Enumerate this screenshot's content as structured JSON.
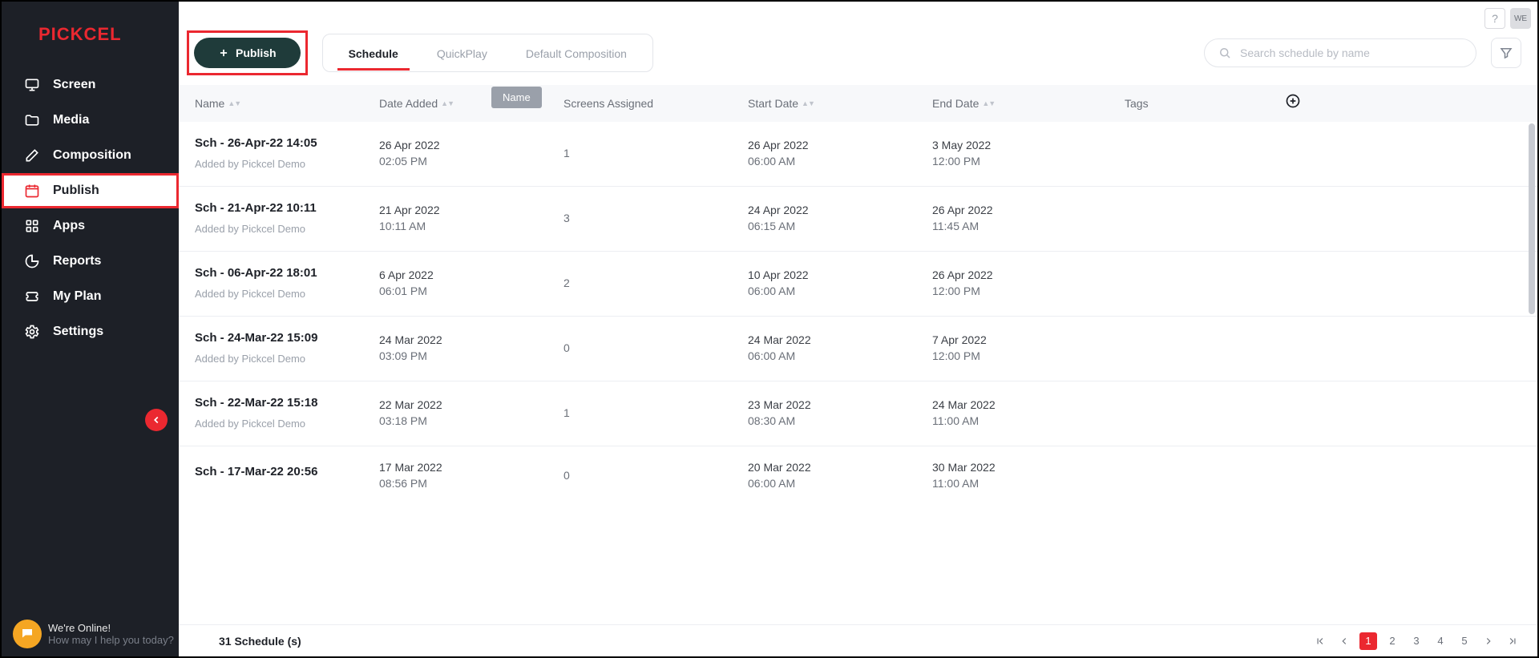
{
  "brand": "PICKCEL",
  "sidebar": {
    "items": [
      {
        "label": "Screen"
      },
      {
        "label": "Media"
      },
      {
        "label": "Composition"
      },
      {
        "label": "Publish"
      },
      {
        "label": "Apps"
      },
      {
        "label": "Reports"
      },
      {
        "label": "My Plan"
      },
      {
        "label": "Settings"
      }
    ],
    "online": {
      "line1": "We're Online!",
      "line2": "How may I help you today?"
    }
  },
  "topbar": {
    "help": "?",
    "avatar": "WE"
  },
  "toolbar": {
    "publish_label": "Publish",
    "tabs": [
      {
        "label": "Schedule"
      },
      {
        "label": "QuickPlay"
      },
      {
        "label": "Default Composition"
      }
    ],
    "search_placeholder": "Search schedule by name"
  },
  "columns": {
    "name": "Name",
    "date_added": "Date Added",
    "screens": "Screens Assigned",
    "start": "Start Date",
    "end": "End Date",
    "tags": "Tags",
    "name_tooltip": "Name"
  },
  "rows": [
    {
      "name": "Sch - 26-Apr-22 14:05",
      "sub": "Added by Pickcel Demo",
      "added_d": "26 Apr 2022",
      "added_t": "02:05 PM",
      "screens": "1",
      "start_d": "26 Apr 2022",
      "start_t": "06:00 AM",
      "end_d": "3 May 2022",
      "end_t": "12:00 PM"
    },
    {
      "name": "Sch - 21-Apr-22 10:11",
      "sub": "Added by Pickcel Demo",
      "added_d": "21 Apr 2022",
      "added_t": "10:11 AM",
      "screens": "3",
      "start_d": "24 Apr 2022",
      "start_t": "06:15 AM",
      "end_d": "26 Apr 2022",
      "end_t": "11:45 AM"
    },
    {
      "name": "Sch - 06-Apr-22 18:01",
      "sub": "Added by Pickcel Demo",
      "added_d": "6 Apr 2022",
      "added_t": "06:01 PM",
      "screens": "2",
      "start_d": "10 Apr 2022",
      "start_t": "06:00 AM",
      "end_d": "26 Apr 2022",
      "end_t": "12:00 PM"
    },
    {
      "name": "Sch - 24-Mar-22 15:09",
      "sub": "Added by Pickcel Demo",
      "added_d": "24 Mar 2022",
      "added_t": "03:09 PM",
      "screens": "0",
      "start_d": "24 Mar 2022",
      "start_t": "06:00 AM",
      "end_d": "7 Apr 2022",
      "end_t": "12:00 PM"
    },
    {
      "name": "Sch - 22-Mar-22 15:18",
      "sub": "Added by Pickcel Demo",
      "added_d": "22 Mar 2022",
      "added_t": "03:18 PM",
      "screens": "1",
      "start_d": "23 Mar 2022",
      "start_t": "08:30 AM",
      "end_d": "24 Mar 2022",
      "end_t": "11:00 AM"
    },
    {
      "name": "Sch - 17-Mar-22 20:56",
      "sub": "",
      "added_d": "17 Mar 2022",
      "added_t": "08:56 PM",
      "screens": "0",
      "start_d": "20 Mar 2022",
      "start_t": "06:00 AM",
      "end_d": "30 Mar 2022",
      "end_t": "11:00 AM"
    }
  ],
  "footer": {
    "count": "31 Schedule (s)",
    "pages": [
      "1",
      "2",
      "3",
      "4",
      "5"
    ]
  }
}
